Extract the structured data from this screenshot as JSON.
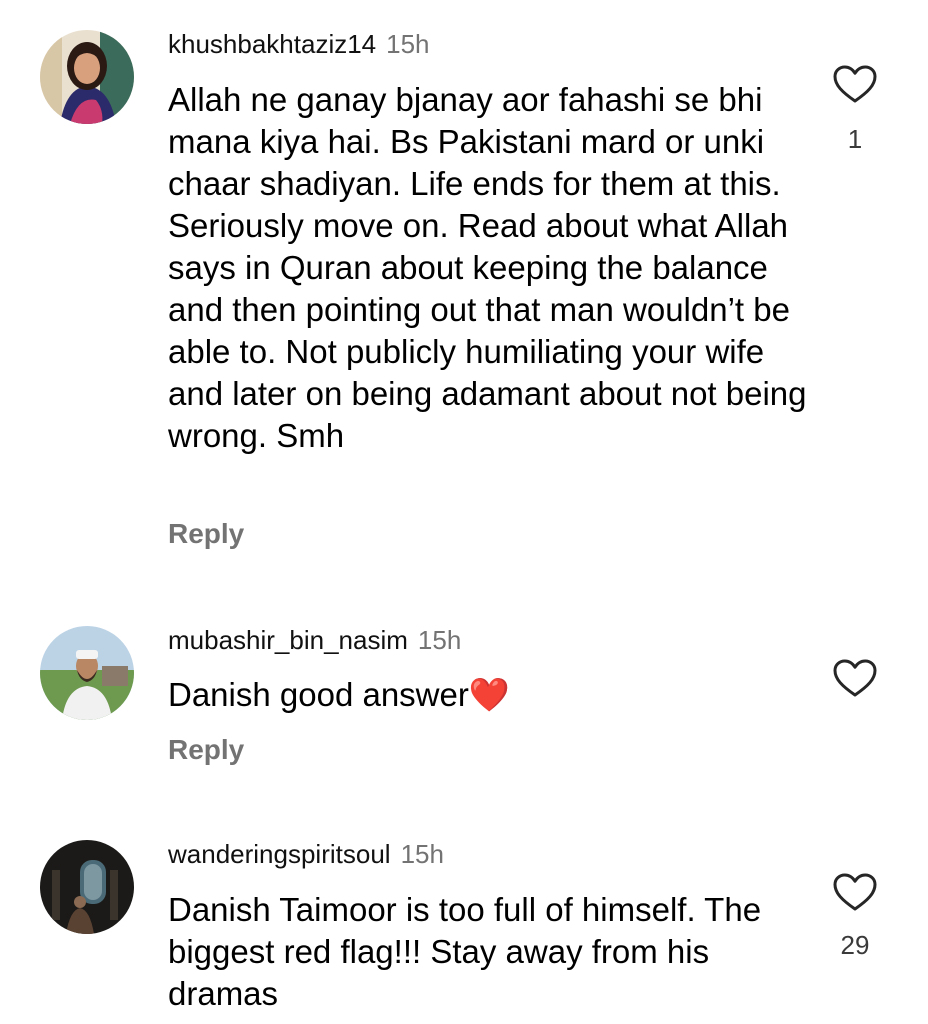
{
  "reply_label": "Reply",
  "comments": [
    {
      "username": "khushbakhtaziz14",
      "time": "15h",
      "text": "Allah ne ganay bjanay aor fahashi se bhi mana kiya hai. Bs Pakistani mard or unki chaar shadiyan. Life ends for them at this. Seriously move on. Read about what Allah says in Quran about keeping the balance and then pointing out that man wouldn’t be able to. Not publicly humiliating your wife and later on being adamant about not being wrong. Smh",
      "likes": "1"
    },
    {
      "username": "mubashir_bin_nasim",
      "time": "15h",
      "text": "Danish good answer❤️",
      "likes": ""
    },
    {
      "username": "wanderingspiritsoul",
      "time": "15h",
      "text": "Danish Taimoor is too full of himself. The biggest red flag!!! Stay away from his dramas",
      "likes": "29"
    }
  ],
  "colors": {
    "secondary_text": "#737373",
    "primary_text": "#000000",
    "heart_outline": "#262626"
  }
}
